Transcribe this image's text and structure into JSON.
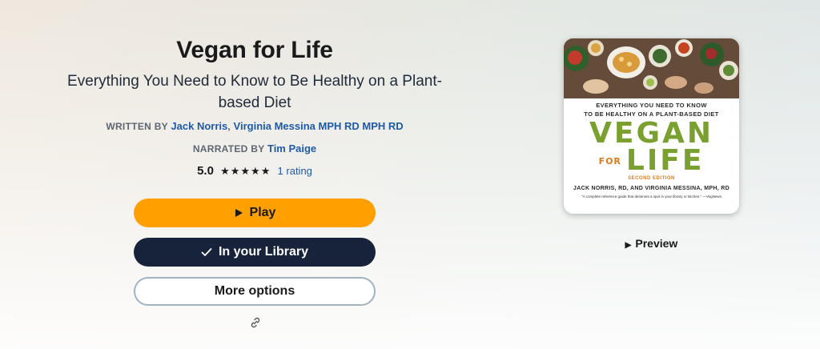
{
  "book": {
    "title": "Vegan for Life",
    "subtitle": "Everything You Need to Know to Be Healthy on a Plant-based Diet",
    "written_by_label": "WRITTEN BY",
    "authors": [
      "Jack Norris",
      "Virginia Messina MPH RD MPH RD"
    ],
    "author_separator": ",",
    "narrated_by_label": "NARRATED BY",
    "narrator": "Tim Paige",
    "rating_value": "5.0",
    "rating_stars": 5,
    "stars_glyph": "★★★★★",
    "rating_count": "1 rating"
  },
  "actions": {
    "play_label": "Play",
    "library_label": "In your Library",
    "more_label": "More options",
    "preview_label": "Preview"
  },
  "cover": {
    "tagline_1": "EVERYTHING YOU NEED TO KNOW",
    "tagline_2": "TO BE HEALTHY ON A PLANT-BASED DIET",
    "word_1": "VEGAN",
    "word_2": "FOR",
    "word_3": "LIFE",
    "edition": "SECOND EDITION",
    "authors_line": "JACK NORRIS, RD, AND VIRGINIA MESSINA, MPH, RD",
    "quote": "\"A complete reference guide that deserves a spot in your library or kitchen.\" —VegNews"
  },
  "icons": {
    "play": "play-icon",
    "check": "check-icon",
    "link": "link-icon",
    "preview": "play-triangle-icon",
    "star": "star-icon"
  },
  "colors": {
    "accent_orange": "#ffa000",
    "library_navy": "#17233a",
    "link_blue": "#1e5aa8",
    "cover_green": "#7aa12f"
  }
}
